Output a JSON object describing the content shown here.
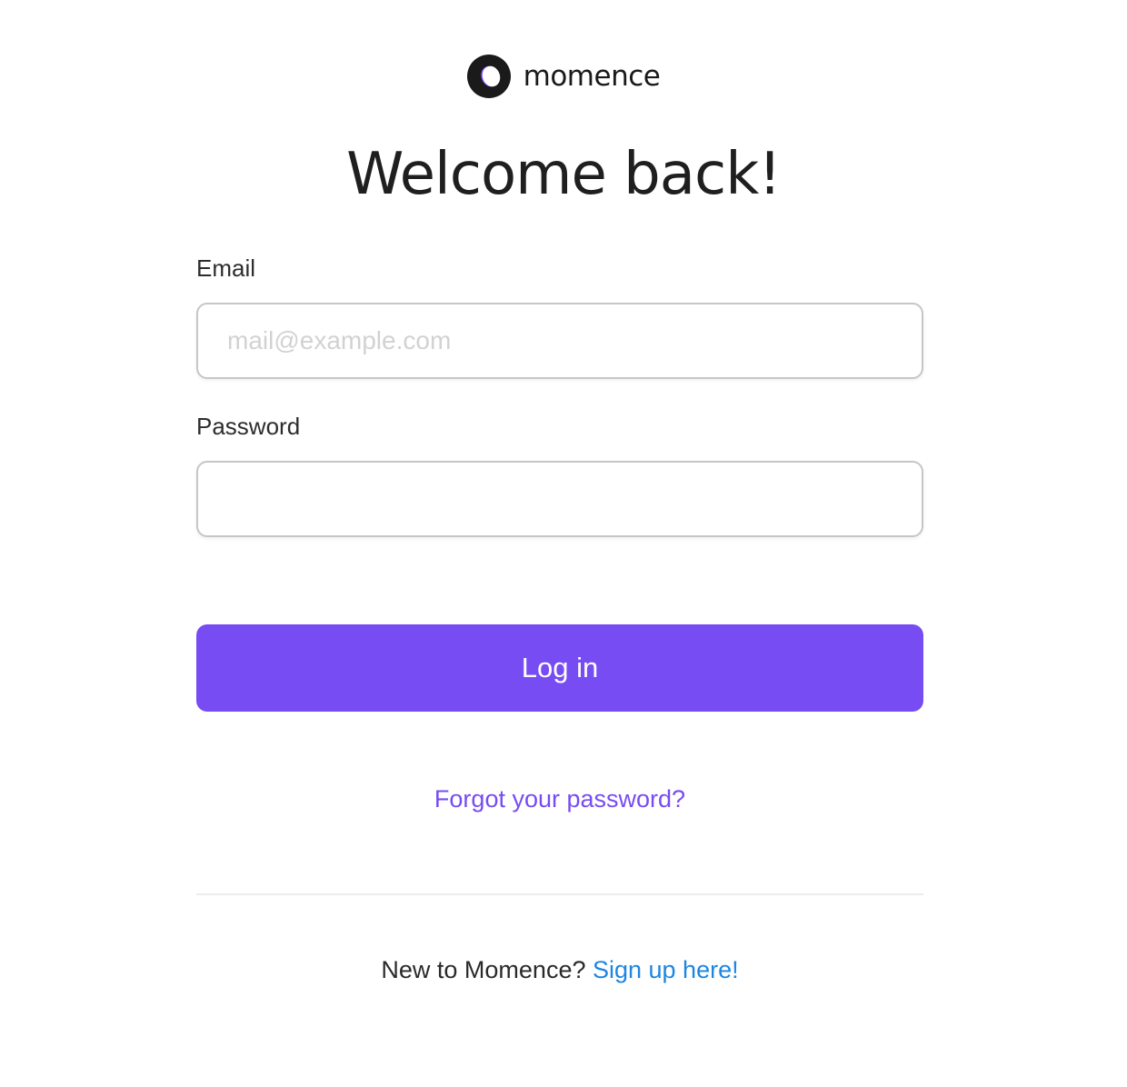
{
  "brand": {
    "name": "momence",
    "colors": {
      "accent": "#774cf2",
      "link": "#1c86e2",
      "logo_dark": "#1a1a1a"
    }
  },
  "heading": "Welcome back!",
  "form": {
    "email": {
      "label": "Email",
      "placeholder": "mail@example.com",
      "value": ""
    },
    "password": {
      "label": "Password",
      "value": ""
    },
    "submit_label": "Log in",
    "forgot_label": "Forgot your password?"
  },
  "footer": {
    "prompt": "New to Momence?",
    "signup_label": "Sign up here!"
  }
}
